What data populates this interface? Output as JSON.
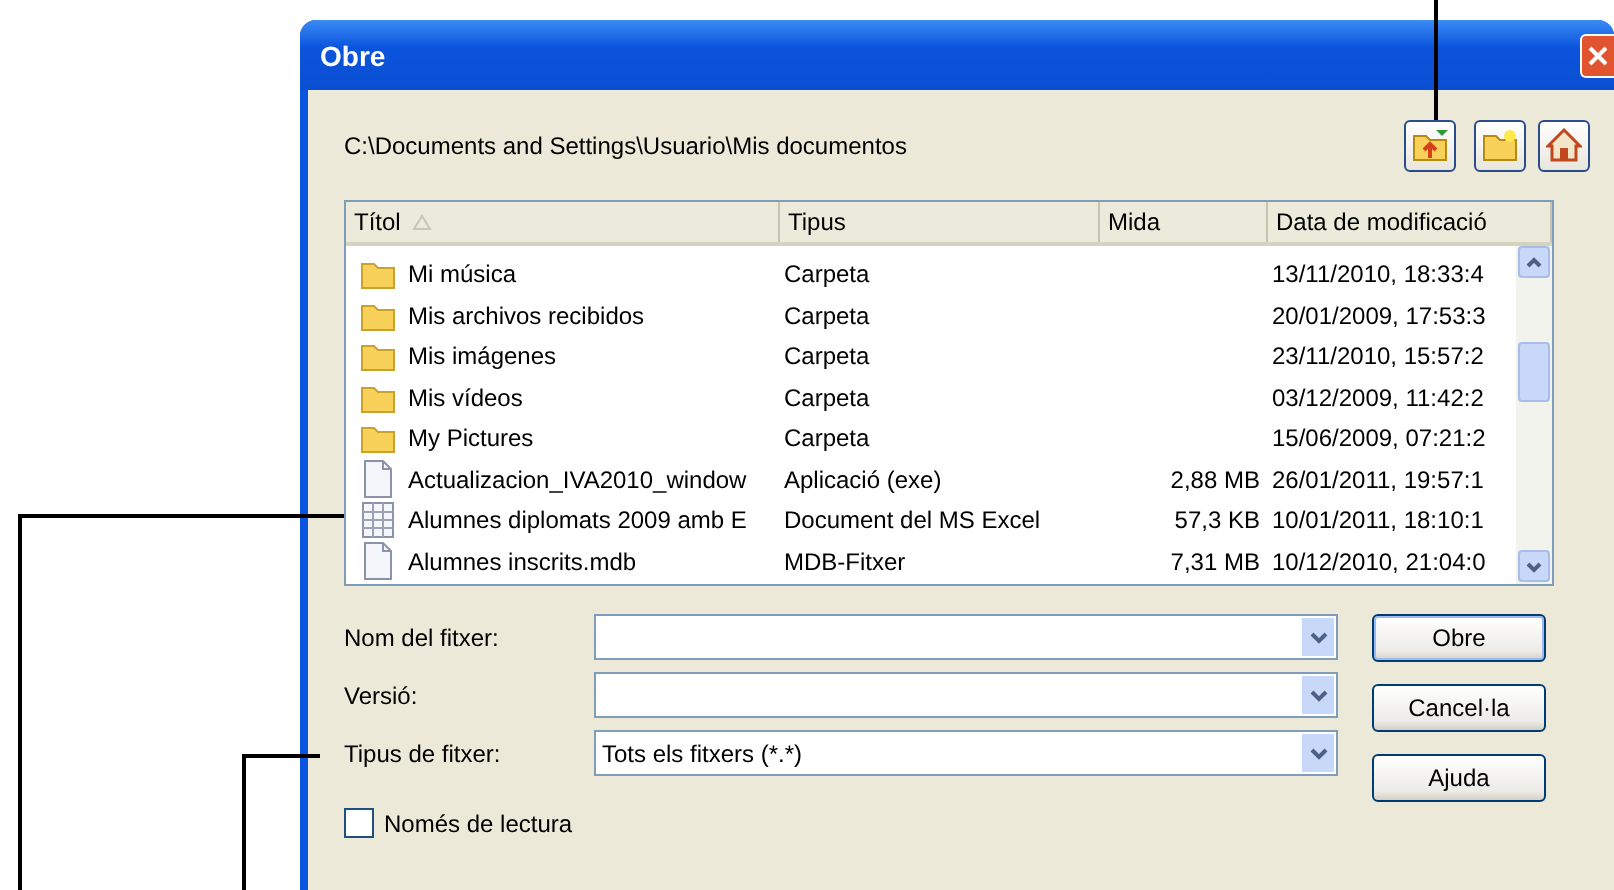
{
  "window": {
    "title": "Obre"
  },
  "path": "C:\\Documents and Settings\\Usuario\\Mis documentos",
  "toolbar": [
    {
      "kind": "up"
    },
    {
      "kind": "new-folder"
    },
    {
      "kind": "home"
    }
  ],
  "table": {
    "columns": [
      {
        "label": "Títol",
        "sorted": true
      },
      {
        "label": "Tipus",
        "sorted": false
      },
      {
        "label": "Mida",
        "sorted": false
      },
      {
        "label": "Data de modificació",
        "sorted": false
      }
    ],
    "rows": [
      {
        "kind": "folder",
        "name": "Mi música",
        "type": "Carpeta",
        "date": "13/11/2010, 18:33:4"
      },
      {
        "kind": "folder",
        "name": "Mis archivos recibidos",
        "type": "Carpeta",
        "date": "20/01/2009, 17:53:3"
      },
      {
        "kind": "folder",
        "name": "Mis imágenes",
        "type": "Carpeta",
        "date": "23/11/2010, 15:57:2"
      },
      {
        "kind": "folder",
        "name": "Mis vídeos",
        "type": "Carpeta",
        "date": "03/12/2009, 11:42:2"
      },
      {
        "kind": "folder",
        "name": "My Pictures",
        "type": "Carpeta",
        "date": "15/06/2009, 07:21:2"
      },
      {
        "kind": "file",
        "name": "Actualizacion_IVA2010_window",
        "type": "Aplicació (exe)",
        "size": "2,88 MB",
        "date": "26/01/2011, 19:57:1"
      },
      {
        "kind": "spreadsheet",
        "name": "Alumnes diplomats 2009 amb E",
        "type": "Document del MS Excel",
        "size": "57,3 KB",
        "date": "10/01/2011, 18:10:1"
      },
      {
        "kind": "file",
        "name": "Alumnes inscrits.mdb",
        "type": "MDB-Fitxer",
        "size": "7,31 MB",
        "date": "10/12/2010, 21:04:0"
      }
    ]
  },
  "fields": [
    {
      "label": "Nom del fitxer:"
    },
    {
      "label": "Versió:"
    },
    {
      "label": "Tipus de fitxer:",
      "value": "Tots els fitxers (*.*)"
    }
  ],
  "buttons": [
    {
      "label": "Obre",
      "default": true
    },
    {
      "label": "Cancel·la",
      "default": false
    },
    {
      "label": "Ajuda",
      "default": false
    }
  ],
  "readonly": {
    "label": "Només de lectura",
    "checked": false
  }
}
